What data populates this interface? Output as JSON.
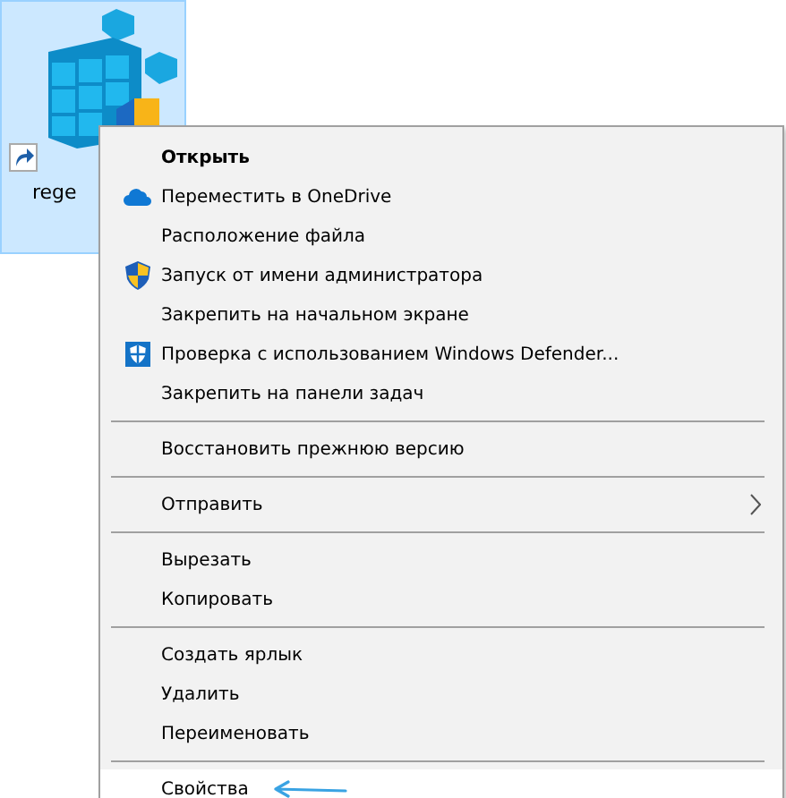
{
  "desktop_icon": {
    "label": "rege",
    "selected": true,
    "shortcut": true
  },
  "context_menu": {
    "items": [
      {
        "kind": "item",
        "label": "Открыть",
        "bold": true,
        "selected": false
      },
      {
        "kind": "cloud",
        "label": "Переместить в OneDrive",
        "selected": false
      },
      {
        "kind": "item",
        "label": "Расположение файла",
        "selected": false
      },
      {
        "kind": "shield",
        "label": "Запуск от имени администратора",
        "selected": false
      },
      {
        "kind": "item",
        "label": "Закрепить на начальном экране",
        "selected": false
      },
      {
        "kind": "defender",
        "label": "Проверка с использованием Windows Defender...",
        "selected": false
      },
      {
        "kind": "item",
        "label": "Закрепить на панели задач",
        "selected": false
      },
      {
        "kind": "separator"
      },
      {
        "kind": "item",
        "label": "Восстановить прежнюю версию",
        "selected": false
      },
      {
        "kind": "separator"
      },
      {
        "kind": "item",
        "label": "Отправить",
        "submenu": true,
        "selected": false
      },
      {
        "kind": "separator"
      },
      {
        "kind": "item",
        "label": "Вырезать",
        "selected": false
      },
      {
        "kind": "item",
        "label": "Копировать",
        "selected": false
      },
      {
        "kind": "separator"
      },
      {
        "kind": "item",
        "label": "Создать ярлык",
        "selected": false
      },
      {
        "kind": "item",
        "label": "Удалить",
        "selected": false
      },
      {
        "kind": "item",
        "label": "Переименовать",
        "selected": false
      },
      {
        "kind": "separator"
      },
      {
        "kind": "item",
        "label": "Свойства",
        "selected": true,
        "pointer_arrow": true
      }
    ]
  }
}
